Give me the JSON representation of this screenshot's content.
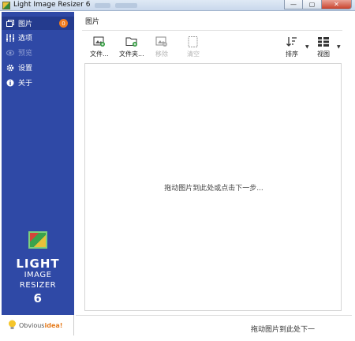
{
  "window": {
    "title": "Light Image Resizer 6",
    "buttons": {
      "minimize": "—",
      "maximize": "▢",
      "close": "✕"
    }
  },
  "sidebar": {
    "items": [
      {
        "label": "图片",
        "icon": "images-icon",
        "badge": "0",
        "active": true,
        "disabled": false
      },
      {
        "label": "选项",
        "icon": "sliders-icon",
        "active": false,
        "disabled": false
      },
      {
        "label": "预览",
        "icon": "eye-icon",
        "active": false,
        "disabled": true
      },
      {
        "label": "设置",
        "icon": "gear-icon",
        "active": false,
        "disabled": false
      },
      {
        "label": "关于",
        "icon": "info-icon",
        "active": false,
        "disabled": false
      }
    ],
    "logo": {
      "line1": "LIGHT",
      "line2": "IMAGE",
      "line3": "RESIZER",
      "line4": "6"
    }
  },
  "footer": {
    "brand_prefix": "Obvious",
    "brand_suffix": "idea!",
    "hint": "拖动图片到此处下一"
  },
  "main": {
    "title": "图片",
    "toolbar": {
      "add_files": "文件...",
      "add_folder": "文件夹...",
      "remove": "移除",
      "clear": "清空",
      "sort": "排序",
      "view": "视图"
    },
    "drop_hint": "拖动图片到此处或点击下一步..."
  },
  "colors": {
    "sidebar": "#2f49a6",
    "sidebar_active": "#243b8e",
    "badge": "#f07c1f",
    "accent": "#e57b1c"
  }
}
